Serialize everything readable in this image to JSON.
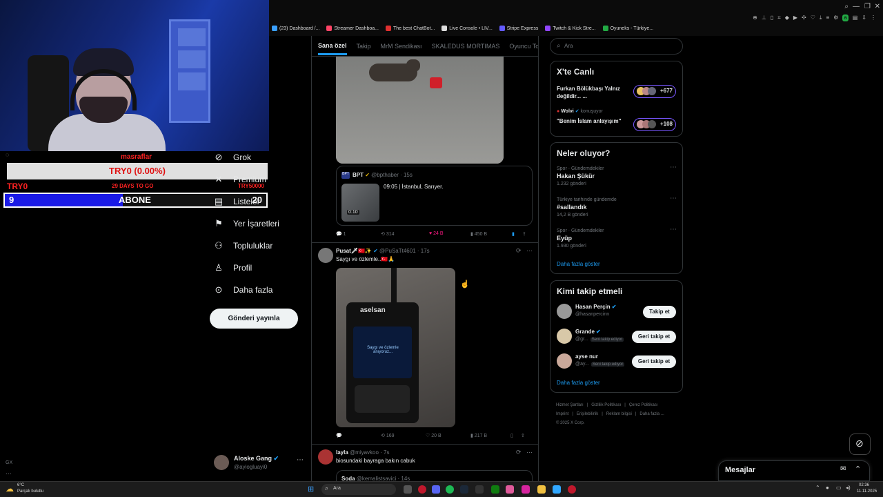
{
  "bookmarks": [
    {
      "label": "(23) Dashboard /...",
      "color": "#3aa0ff"
    },
    {
      "label": "Streamer Dashboa...",
      "color": "#ff4466"
    },
    {
      "label": "The best ChatBot...",
      "color": "#e03030"
    },
    {
      "label": "Live Console • LIV...",
      "color": "#dddddd"
    },
    {
      "label": "Stripe Express",
      "color": "#635bff"
    },
    {
      "label": "Twitch & Kick Stre...",
      "color": "#9146ff"
    },
    {
      "label": "Oyuneks - Türkiye...",
      "color": "#22aa44"
    }
  ],
  "overlay": {
    "top_label": "masraflar",
    "bar_text": "TRY0 (0.00%)",
    "left_small": "TRY0",
    "mid_small": "29 DAYS TO GO",
    "right_small": "TRY50000",
    "sub_left": "9",
    "sub_label": "ABONE",
    "sub_right": "20",
    "sub_progress": 0.45
  },
  "nav": {
    "items": [
      {
        "label": "Grok",
        "icon": "grok-icon"
      },
      {
        "label": "Premium",
        "icon": "x-premium-icon"
      },
      {
        "label": "Listeler",
        "icon": "list-icon"
      },
      {
        "label": "Yer İşaretleri",
        "icon": "bookmark-icon"
      },
      {
        "label": "Topluluklar",
        "icon": "communities-icon"
      },
      {
        "label": "Profil",
        "icon": "profile-icon"
      },
      {
        "label": "Daha fazla",
        "icon": "more-icon"
      }
    ],
    "post_button": "Gönderi yayınla",
    "account_name": "Aloske Gang",
    "account_handle": "@ayiogluayi0"
  },
  "tabs": [
    "Sana özel",
    "Takip",
    "MrM Sendikası",
    "SKALEDUS MORTIMAS",
    "Oyuncu Top"
  ],
  "tweet1": {
    "quote_name": "BPT",
    "quote_handle": "@bpthaber · 15s",
    "quote_text": "09:05 | İstanbul, Sarıyer.",
    "video_time": "0:10",
    "replies": "1",
    "retweets": "314",
    "likes": "24 B",
    "views": "450 B"
  },
  "tweet2": {
    "name": "Pusat🗡🇹🇷✨",
    "handle": "@PuSaTt4601 · 17s",
    "text": "Saygı ve özlemle..🇹🇷🙏",
    "radio_brand": "aselsan",
    "screen_text": "Saygı ve özlemle anıyoruz...",
    "replies": "",
    "retweets": "169",
    "likes": "20 B",
    "views": "217 B"
  },
  "tweet3": {
    "name": "layla",
    "handle": "@miyavkoo · 7s",
    "text": "biosundaki bayraga bakın cabuk",
    "quote_name": "Soda",
    "quote_handle": "@kemalistsavici · 14s"
  },
  "search": {
    "placeholder": "Ara"
  },
  "live": {
    "title": "X'te Canlı",
    "items": [
      {
        "host": "",
        "title": "Furkan Bölükbaşı Yalnız değildir... ...",
        "count": "+677"
      },
      {
        "host": "Wolvi",
        "host_suffix": "konuşuyor",
        "title": "\"Benim İslam anlayışım\"",
        "count": "+108"
      }
    ]
  },
  "trends": {
    "title": "Neler oluyor?",
    "items": [
      {
        "category": "Spor · Gündemdekiler",
        "title": "Hakan Şükür",
        "count": "1.232 gönderi"
      },
      {
        "category": "Türkiye tarihinde gündemde",
        "title": "#sallandık",
        "count": "14,2 B gönderi"
      },
      {
        "category": "Spor · Gündemdekiler",
        "title": "Eyüp",
        "count": "1.930 gönderi"
      }
    ],
    "more": "Daha fazla göster"
  },
  "who_to_follow": {
    "title": "Kimi takip etmeli",
    "items": [
      {
        "name": "Hasan Perçin",
        "handle": "@hasanpercinn",
        "badge": "",
        "button": "Takip et"
      },
      {
        "name": "Grande",
        "handle": "@gr...",
        "badge": "Seni takip ediyor",
        "button": "Geri takip et"
      },
      {
        "name": "ayse nur",
        "handle": "@ay...",
        "badge": "Seni takip ediyor",
        "button": "Geri takip et"
      }
    ],
    "more": "Daha fazla göster"
  },
  "footer": {
    "links": [
      "Hizmet Şartları",
      "Gizlilik Politikası",
      "Çerez Politikası",
      "Imprint",
      "Erişilebilirlik",
      "Reklam bilgisi",
      "Daha fazla ..."
    ],
    "copyright": "© 2025 X Corp."
  },
  "messages": {
    "title": "Mesajlar"
  },
  "taskbar": {
    "weather_temp": "6°C",
    "weather_desc": "Parçalı bulutlu",
    "search": "Ara",
    "time": "02:36",
    "date": "11.11.2025"
  },
  "side_labels": {
    "gx": "GX"
  }
}
